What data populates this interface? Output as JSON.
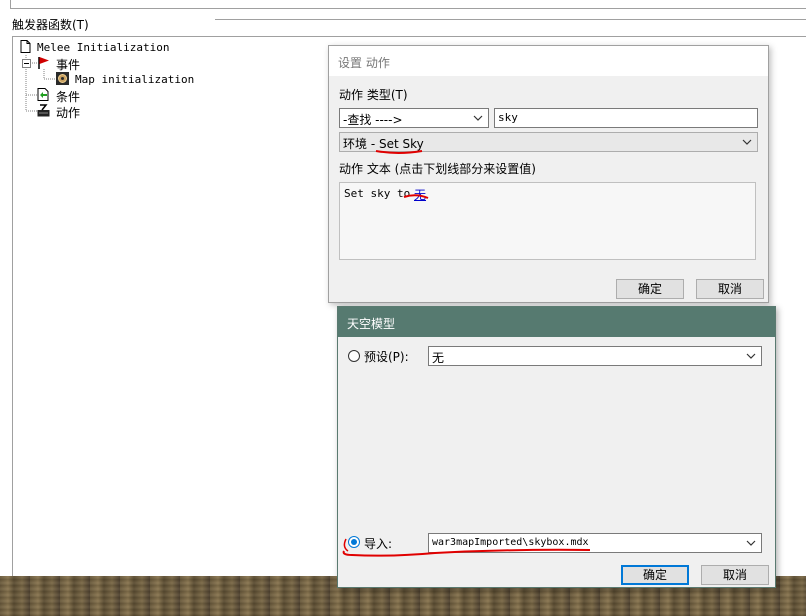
{
  "group": {
    "title": "触发器函数(T)"
  },
  "tree": {
    "root": "Melee Initialization",
    "events_label": "事件",
    "event_item": "Map initialization",
    "conditions_label": "条件",
    "actions_label": "动作"
  },
  "action_dialog": {
    "title": "设置 动作",
    "type_label": "动作 类型(T)",
    "search_combo": "-查找 ---->",
    "search_text": "sky",
    "action_combo": "环境 - Set Sky",
    "text_label": "动作 文本 (点击下划线部分来设置值)",
    "text_prefix": "Set sky to ",
    "text_value": "无",
    "ok": "确定",
    "cancel": "取消"
  },
  "sky_dialog": {
    "title": "天空模型",
    "preset_label": "预设(P):",
    "preset_value": "无",
    "import_label": "导入:",
    "import_value": "war3mapImported\\skybox.mdx",
    "ok": "确定",
    "cancel": "取消",
    "selected": "import"
  },
  "colors": {
    "sky_title_bg": "#567a70",
    "annotation_red": "#e00000",
    "link_blue": "#0000cc",
    "focus_blue": "#0078d7"
  }
}
